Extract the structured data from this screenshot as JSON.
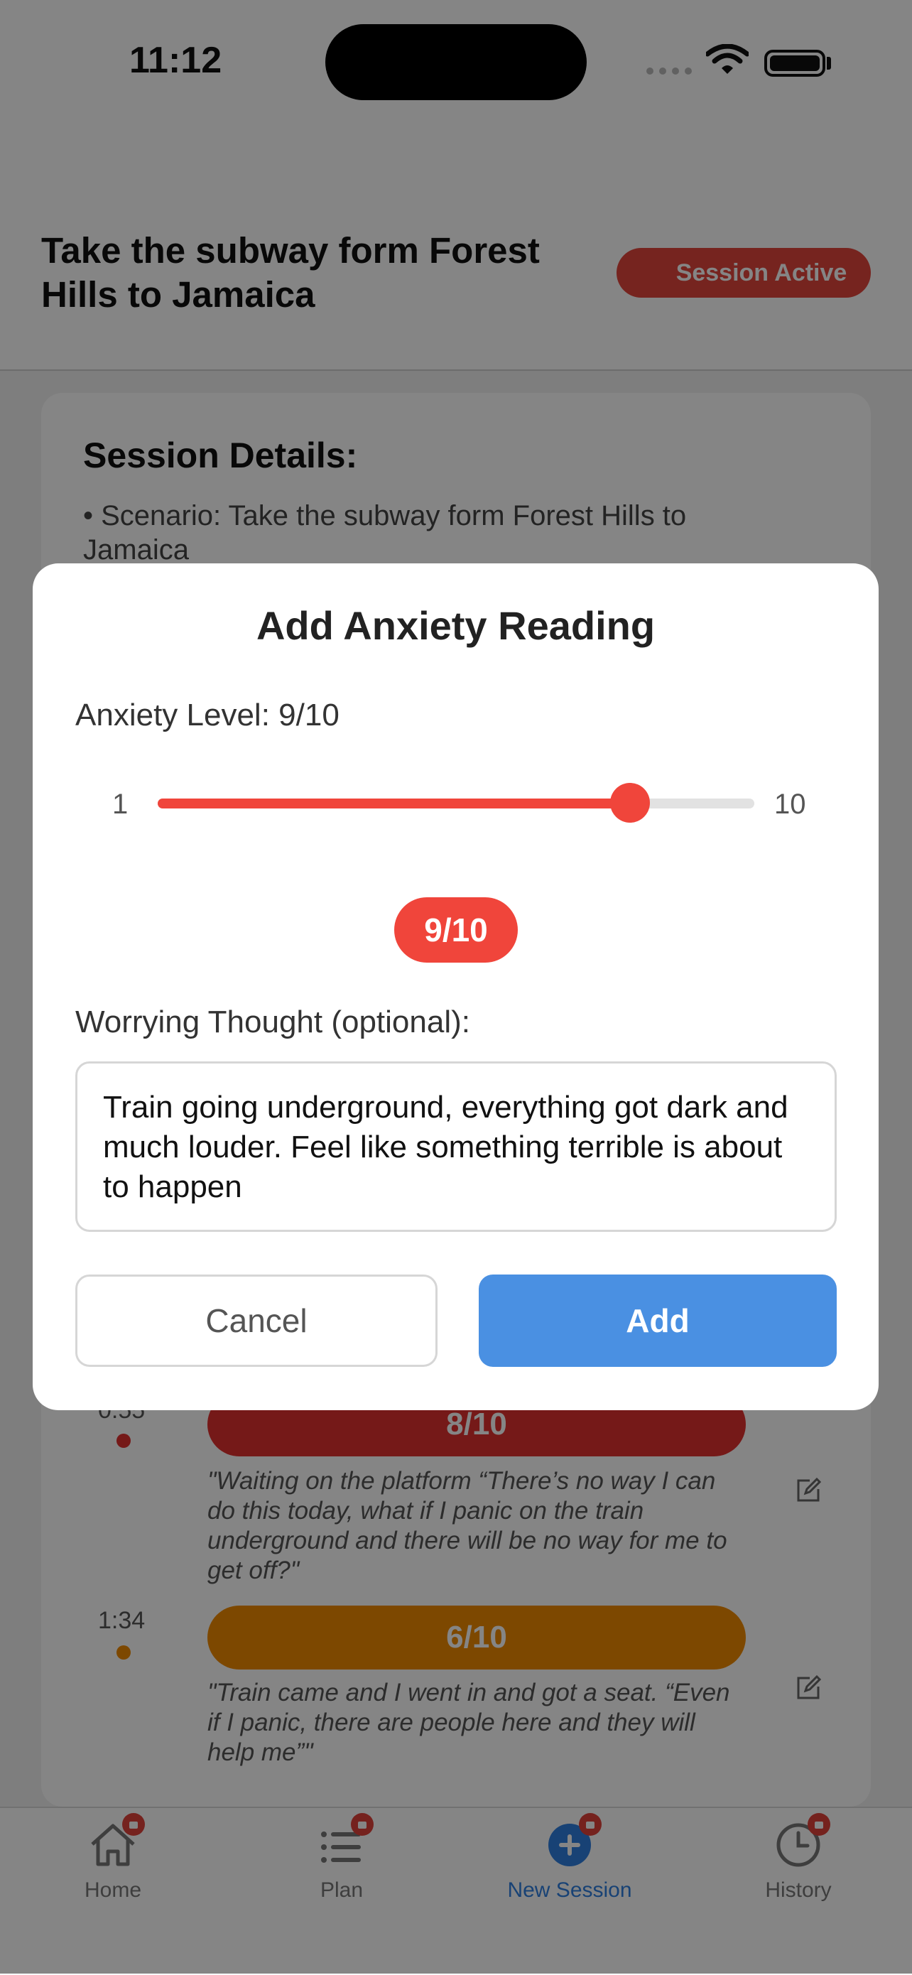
{
  "status_bar": {
    "time": "11:12"
  },
  "header": {
    "title": "Take the subway form Forest Hills to Jamaica",
    "badge": "Session Active"
  },
  "session_details": {
    "title": "Session Details:",
    "scenario_line": "• Scenario: Take the subway form Forest Hills to Jamaica"
  },
  "timeline": [
    {
      "time": "0:55",
      "level": "8/10",
      "color": "#e0302f",
      "note": "\"Waiting on the platform “There’s no way I can do this today, what if I panic on the train underground and there will be no way for me to get off?\""
    },
    {
      "time": "1:34",
      "level": "6/10",
      "color": "#f08a00",
      "note": "\"Train came and I went in and got a seat. “Even if I panic, there are people here and they will help me”\""
    }
  ],
  "modal": {
    "title": "Add Anxiety Reading",
    "level_label": "Anxiety Level: 9/10",
    "slider": {
      "min_label": "1",
      "max_label": "10",
      "min": 1,
      "max": 10,
      "value": 9
    },
    "value_display": "9/10",
    "thought_label": "Worrying Thought (optional):",
    "thought_value": "Train going underground, everything got dark and much louder. Feel like something terrible is about to happen",
    "cancel_label": "Cancel",
    "add_label": "Add"
  },
  "tabbar": {
    "items": [
      {
        "label": "Home",
        "icon": "home-icon"
      },
      {
        "label": "Plan",
        "icon": "list-icon"
      },
      {
        "label": "New Session",
        "icon": "plus-circle-icon",
        "active": true
      },
      {
        "label": "History",
        "icon": "clock-icon"
      }
    ]
  },
  "colors": {
    "accent_red": "#f0453b",
    "accent_blue": "#4a90e2"
  }
}
